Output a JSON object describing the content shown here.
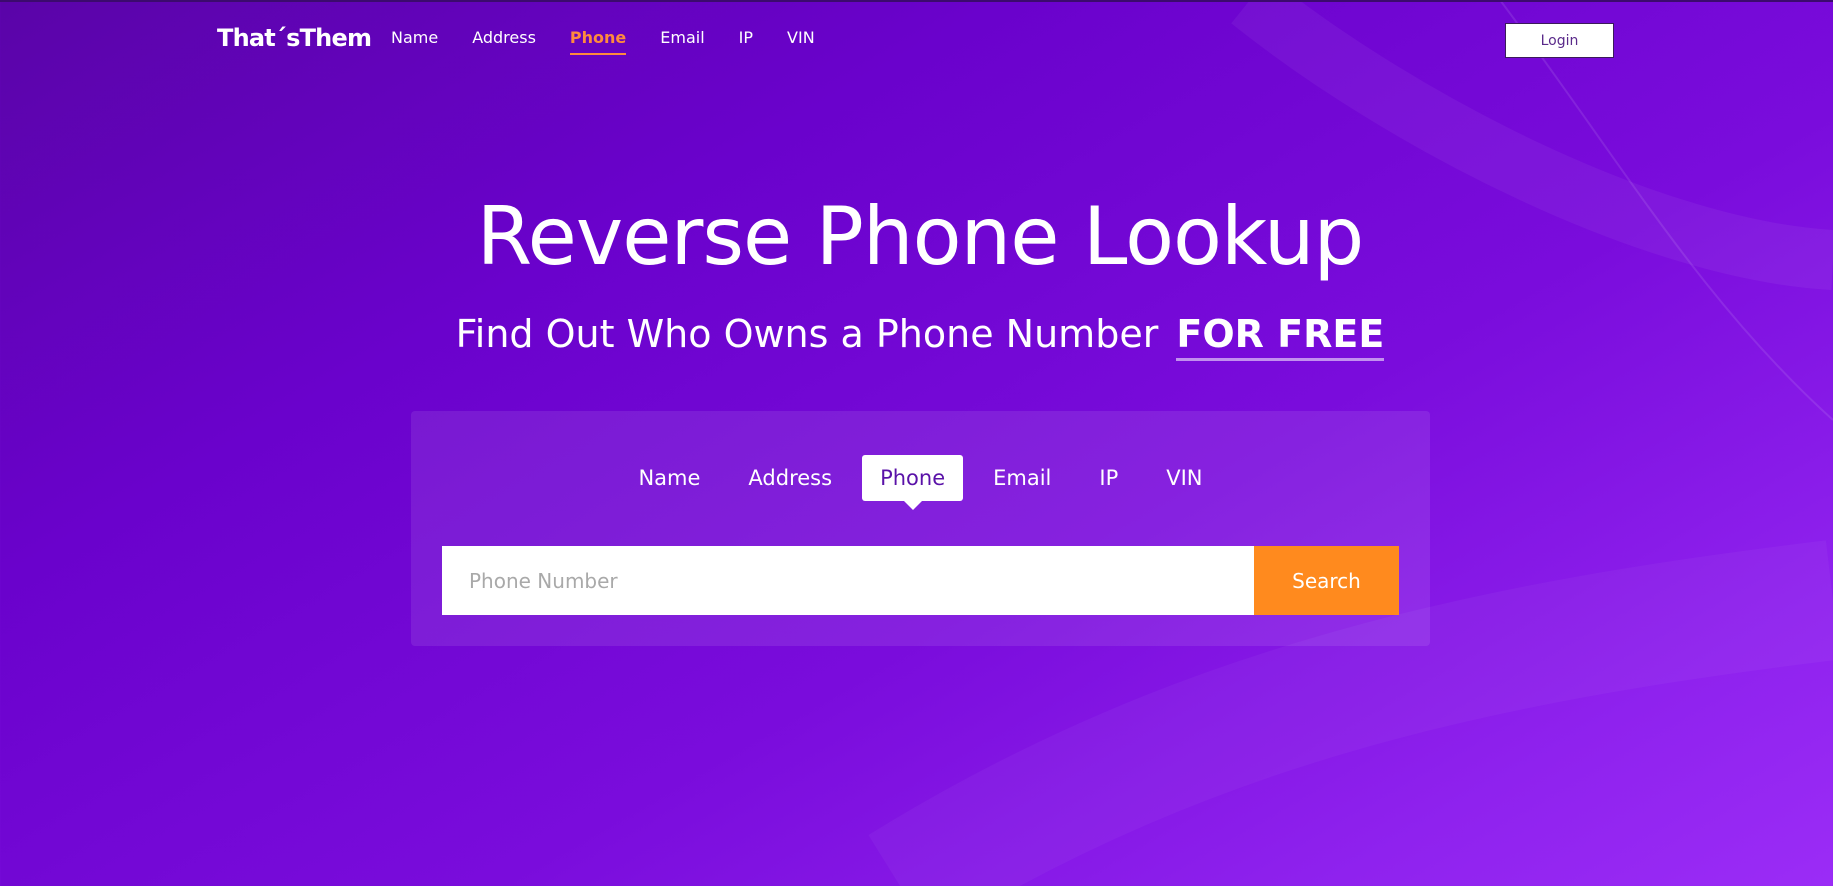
{
  "colors": {
    "accent": "#ff8a3d",
    "search_button": "#ff8a1e",
    "active_tab_text": "#5a12a8"
  },
  "header": {
    "logo": "That´sThem",
    "nav": [
      {
        "label": "Name"
      },
      {
        "label": "Address"
      },
      {
        "label": "Phone",
        "active": true
      },
      {
        "label": "Email"
      },
      {
        "label": "IP"
      },
      {
        "label": "VIN"
      }
    ],
    "login_label": "Login"
  },
  "hero": {
    "title": "Reverse Phone Lookup",
    "subtitle": "Find Out Who Owns a Phone Number",
    "subtitle_emphasis": "FOR FREE"
  },
  "search": {
    "tabs": [
      {
        "label": "Name"
      },
      {
        "label": "Address"
      },
      {
        "label": "Phone",
        "active": true
      },
      {
        "label": "Email"
      },
      {
        "label": "IP"
      },
      {
        "label": "VIN"
      }
    ],
    "placeholder": "Phone Number",
    "value": "",
    "button_label": "Search"
  }
}
